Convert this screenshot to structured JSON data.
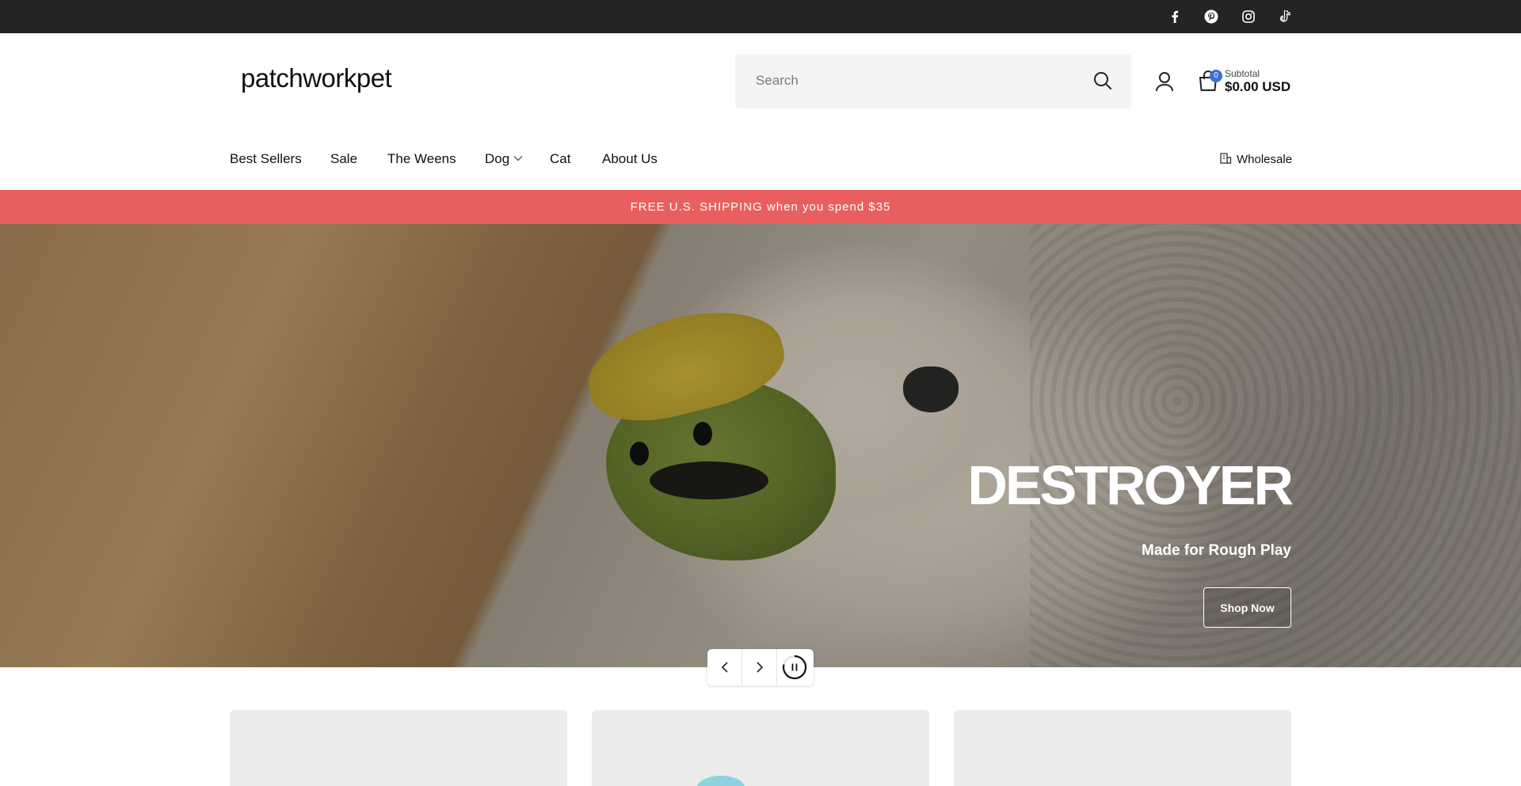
{
  "social": {
    "items": [
      {
        "name": "facebook",
        "icon": "facebook-icon"
      },
      {
        "name": "pinterest",
        "icon": "pinterest-icon"
      },
      {
        "name": "instagram",
        "icon": "instagram-icon"
      },
      {
        "name": "tiktok",
        "icon": "tiktok-icon"
      }
    ]
  },
  "header": {
    "logo": "patchworkpet",
    "search_placeholder": "Search",
    "cart_count": "0",
    "subtotal_label": "Subtotal",
    "subtotal_value": "$0.00 USD"
  },
  "nav": {
    "items": [
      "Best Sellers",
      "Sale",
      "The Weens",
      "Dog",
      "Cat",
      "About Us"
    ],
    "wholesale": "Wholesale"
  },
  "announcement": "FREE U.S. SHIPPING when you spend $35",
  "hero": {
    "title": "DESTROYER",
    "subtitle": "Made for Rough Play",
    "button": "Shop Now"
  },
  "colors": {
    "topbar": "#242424",
    "announcement": "#e95f5f",
    "cart_badge": "#3a6fd8"
  }
}
